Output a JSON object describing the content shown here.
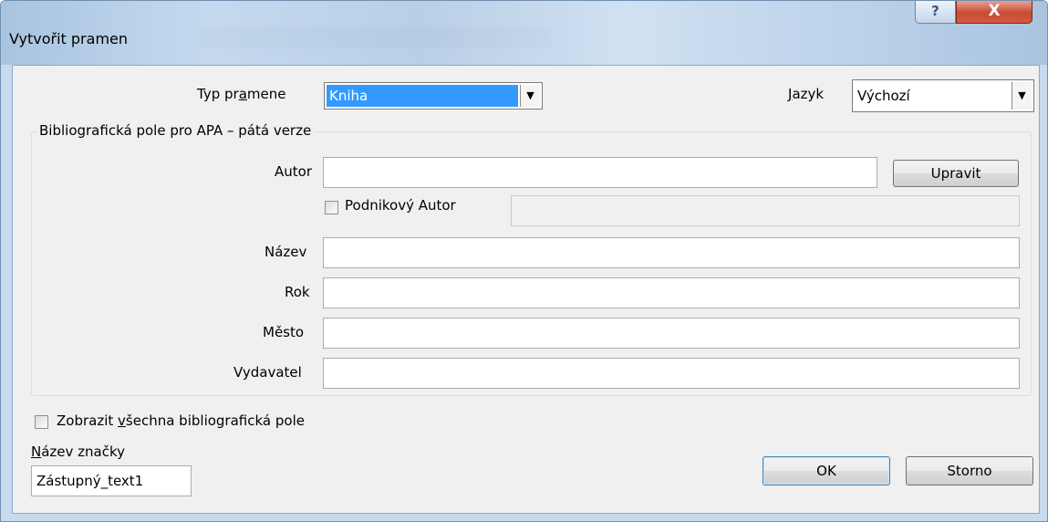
{
  "window": {
    "title": "Vytvořit pramen",
    "help_glyph": "?",
    "close_glyph": "X"
  },
  "source_type": {
    "label_pre": "Typ pr",
    "label_acc": "a",
    "label_post": "mene",
    "value": "Kniha"
  },
  "language": {
    "label_acc": "J",
    "label_post": "azyk",
    "value": "Výchozí"
  },
  "group": {
    "title": "Bibliografická pole pro APA – pátá verze",
    "author_label": "Autor",
    "edit_button": "Upravit",
    "corporate_author_label": "Podnikový Autor",
    "title_label": "Název",
    "year_label": "Rok",
    "city_label": "Město",
    "publisher_label": "Vydavatel"
  },
  "show_all": {
    "label_pre": "Zobrazit ",
    "label_acc": "v",
    "label_post": "šechna bibliografická pole"
  },
  "tag_name": {
    "label_acc": "N",
    "label_post": "ázev značky",
    "value": "Zástupný_text1"
  },
  "buttons": {
    "ok": "OK",
    "cancel": "Storno"
  },
  "icons": {
    "dropdown_arrow": "chevron-down-icon",
    "help": "help-icon",
    "close": "close-icon"
  }
}
